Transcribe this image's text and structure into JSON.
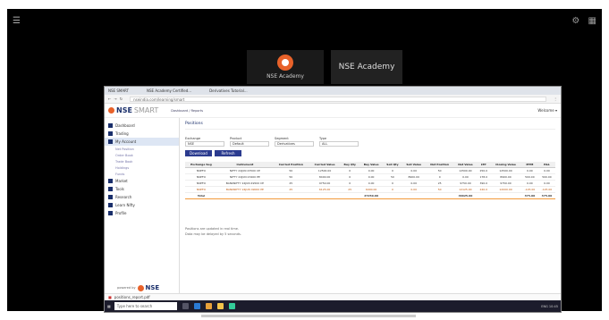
{
  "presenter": {
    "caption": "NSE Academy",
    "name": "NSE Academy"
  },
  "browser": {
    "tabs": [
      "NSE SMART",
      "NSE Academy Certified...",
      "Derivatives Tutorial..."
    ],
    "url": "nseindia.com/learning/smart"
  },
  "app": {
    "logo_text": "NSE",
    "logo_suffix": "SMART",
    "breadcrumb": "Dashboard / Reports",
    "user": "Welcome ▾"
  },
  "sidebar": {
    "items": [
      "Dashboard",
      "Trading",
      "My Account",
      "Market",
      "Tools",
      "Research",
      "Learn Nifty",
      "Profile"
    ],
    "subitems": [
      "Net Position",
      "Order Book",
      "Trade Book",
      "Holdings",
      "Funds"
    ],
    "footer": "NSE",
    "footer_prefix": "powered by"
  },
  "main": {
    "section": "Positions",
    "filters": [
      {
        "label": "Exchange",
        "value": "NSE"
      },
      {
        "label": "Product",
        "value": "Default"
      },
      {
        "label": "Segment",
        "value": "Derivatives"
      },
      {
        "label": "Type",
        "value": "ALL"
      }
    ],
    "buttons": [
      "Download",
      "Refresh"
    ],
    "columns": [
      "Exchange Seg",
      "Instrument",
      "Carried Position",
      "Carried Value",
      "Buy Qty",
      "Buy Value",
      "Sell Qty",
      "Sell Value",
      "Net Position",
      "Net Value",
      "LTP",
      "Closing Value",
      "MTM",
      "P&L"
    ],
    "rows": [
      [
        "NSEFO",
        "NIFTY 24JUN 23500 CE",
        "50",
        "12500.00",
        "0",
        "0.00",
        "0",
        "0.00",
        "50",
        "12500.00",
        "250.0",
        "12500.00",
        "0.00",
        "0.00"
      ],
      [
        "NSEFO",
        "NIFTY 24JUN 23400 PE",
        "50",
        "8400.00",
        "0",
        "0.00",
        "50",
        "8900.00",
        "0",
        "0.00",
        "178.0",
        "8900.00",
        "500.00",
        "500.00"
      ],
      [
        "NSEFO",
        "BANKNIFTY 24JUN 49500 CE",
        "25",
        "9750.00",
        "0",
        "0.00",
        "0",
        "0.00",
        "25",
        "9750.00",
        "390.0",
        "9750.00",
        "0.00",
        "0.00"
      ],
      [
        "NSEFO",
        "BANKNIFTY 24JUN 49000 PE",
        "25",
        "6125.00",
        "25",
        "6000.00",
        "0",
        "0.00",
        "50",
        "12125.00",
        "240.0",
        "12000.00",
        "-125.00",
        "-125.00"
      ]
    ],
    "total_label": "Total",
    "total": [
      "",
      "",
      "",
      "",
      "",
      "27250.00",
      "",
      "",
      "",
      "46625.00",
      "",
      "",
      "375.00",
      "375.00"
    ],
    "notes": [
      "Positions are updated in real time.",
      "Data may be delayed by 5 seconds."
    ]
  },
  "downloads": {
    "file": "positions_report.pdf"
  },
  "taskbar": {
    "search": "Type here to search",
    "tray": "ENG 10:45"
  }
}
